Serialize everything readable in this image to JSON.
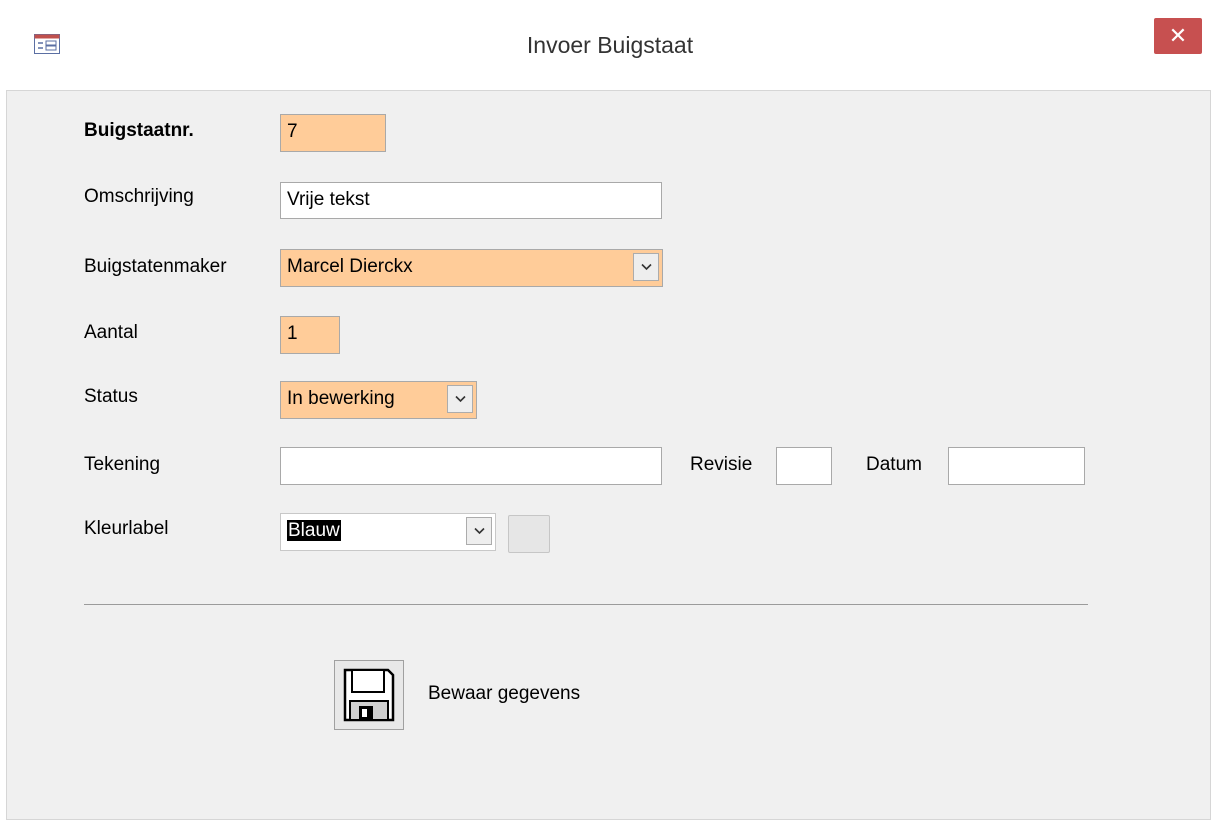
{
  "window": {
    "title": "Invoer Buigstaat",
    "close_glyph": "✕"
  },
  "form": {
    "buigstaatnr": {
      "label": "Buigstaatnr.",
      "value": "7"
    },
    "omschrijving": {
      "label": "Omschrijving",
      "value": "Vrije tekst"
    },
    "buigstatenmaker": {
      "label": "Buigstatenmaker",
      "value": "Marcel Dierckx"
    },
    "aantal": {
      "label": "Aantal",
      "value": "1"
    },
    "status": {
      "label": "Status",
      "value": "In bewerking"
    },
    "tekening": {
      "label": "Tekening",
      "value": ""
    },
    "revisie": {
      "label": "Revisie",
      "value": ""
    },
    "datum": {
      "label": "Datum",
      "value": ""
    },
    "kleurlabel": {
      "label": "Kleurlabel",
      "value": "Blauw"
    }
  },
  "actions": {
    "save_label": "Bewaar gegevens"
  },
  "icons": {
    "app": "form-icon",
    "close": "close-icon",
    "dropdown": "chevron-down-icon",
    "save": "floppy-disk-icon"
  },
  "colors": {
    "required_field_bg": "#ffcc99",
    "client_bg": "#f0f0f0",
    "close_button_bg": "#c75050"
  }
}
